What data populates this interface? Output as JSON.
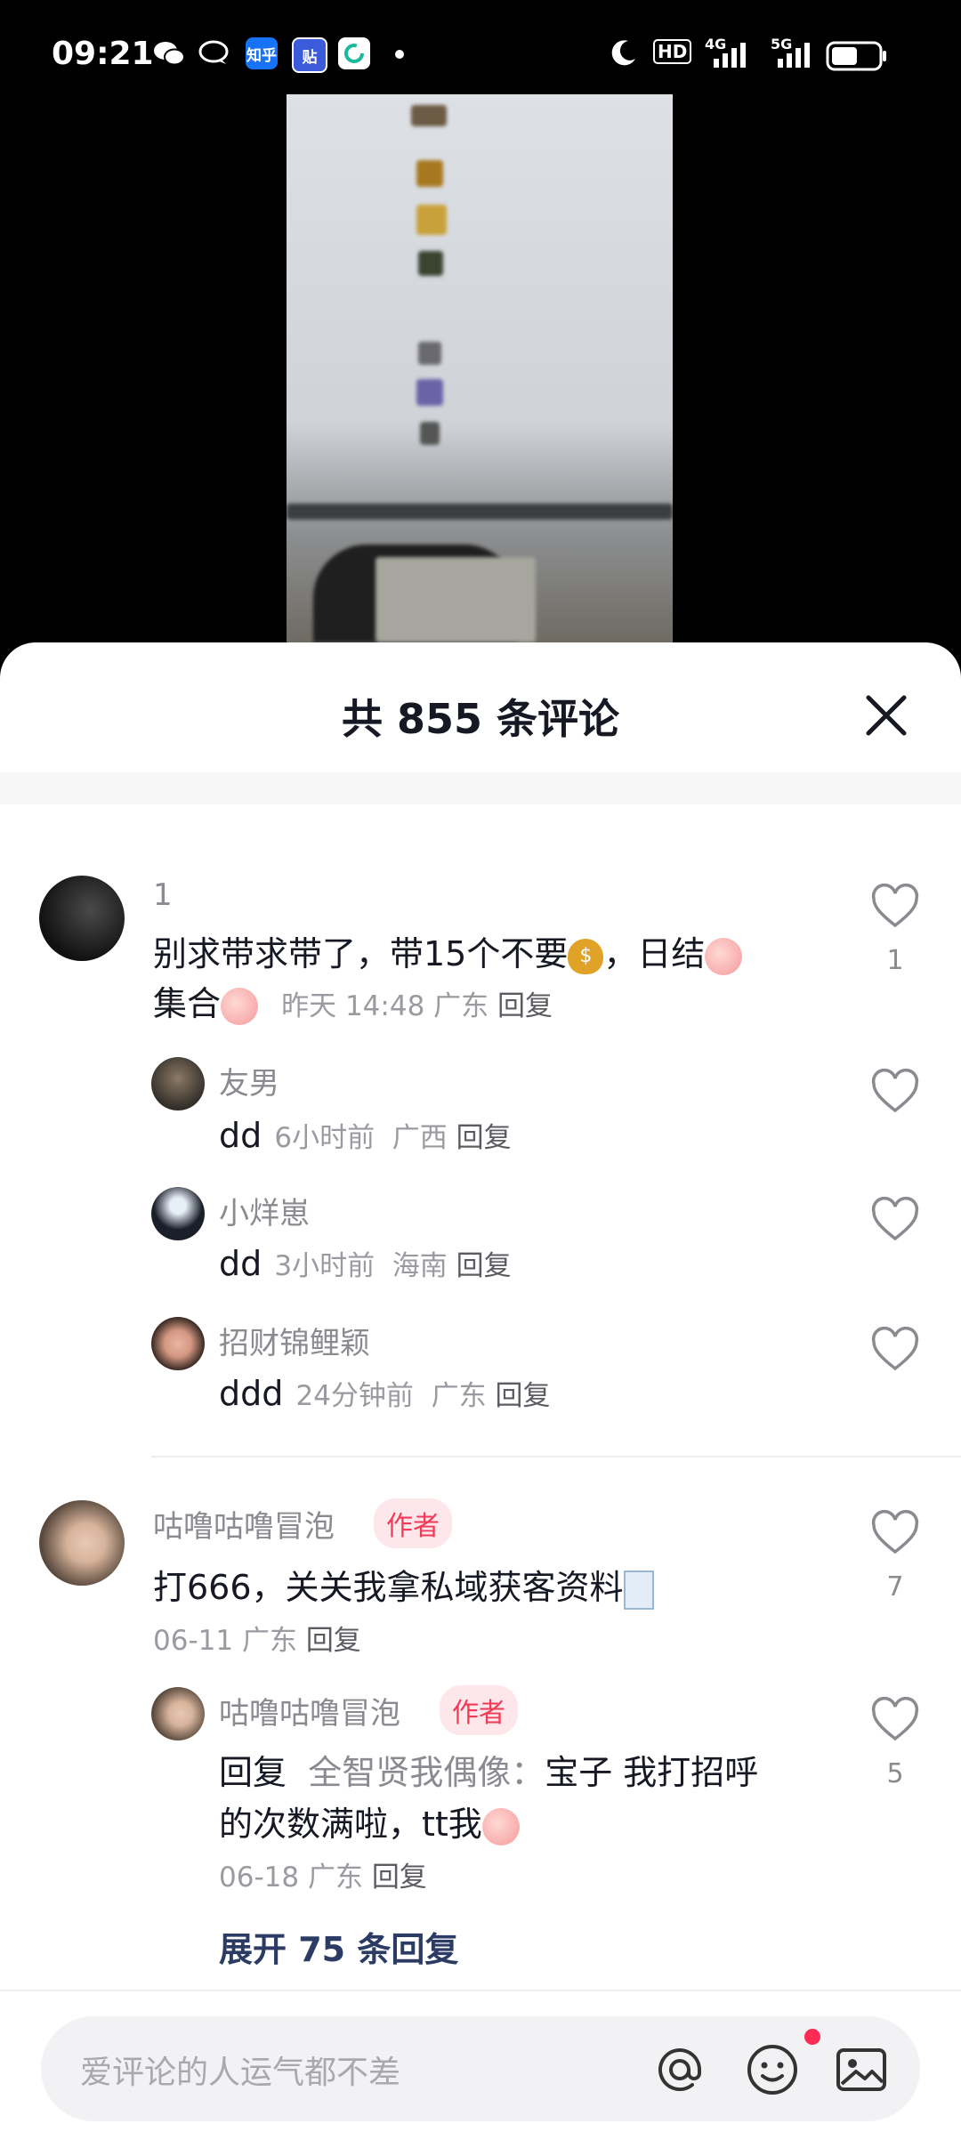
{
  "status_bar": {
    "time": "09:21",
    "apps": [
      "wechat-icon",
      "chat-bubble-icon",
      "zhihu-icon",
      "tieba-icon",
      "refresh-app-icon"
    ],
    "zhihu_label": "知乎",
    "tieba_label": "贴",
    "hd_label": "HD",
    "net1": "4G",
    "net2": "5G"
  },
  "sheet": {
    "title": "共 855 条评论"
  },
  "comments": [
    {
      "name": "1",
      "text_line1": "别求带求带了，带15个不要",
      "text_line1b": "，日结",
      "text_line2": "集合",
      "time": "昨天 14:48",
      "location": "广东",
      "reply": "回复",
      "likes": "1",
      "replies": [
        {
          "name": "友男",
          "text": "dd",
          "time": "6小时前",
          "location": "广西",
          "reply": "回复"
        },
        {
          "name": "小烊崽",
          "text": "dd",
          "time": "3小时前",
          "location": "海南",
          "reply": "回复"
        },
        {
          "name": "招财锦鲤颖",
          "text": "ddd",
          "time": "24分钟前",
          "location": "广东",
          "reply": "回复"
        }
      ]
    },
    {
      "name": "咕噜咕噜冒泡",
      "badge": "作者",
      "text": "打666，关关我拿私域获客资料",
      "time": "06-11",
      "location": "广东",
      "reply": "回复",
      "likes": "7",
      "replies": [
        {
          "name": "咕噜咕噜冒泡",
          "badge": "作者",
          "prefix": "回复",
          "target": "全智贤我偶像：",
          "text_line1": "宝子 我打招呼",
          "text_line2": "的次数满啦，tt我",
          "time": "06-18",
          "location": "广东",
          "reply": "回复",
          "likes": "5"
        }
      ],
      "expand": "展开 75 条回复"
    }
  ],
  "input": {
    "placeholder": "爱评论的人运气都不差",
    "icons": [
      "at-icon",
      "emoji-icon",
      "image-icon"
    ]
  },
  "colors": {
    "accent_red": "#fe2c55",
    "author_badge_text": "#f03a56",
    "expand_text": "#2c3b63"
  }
}
